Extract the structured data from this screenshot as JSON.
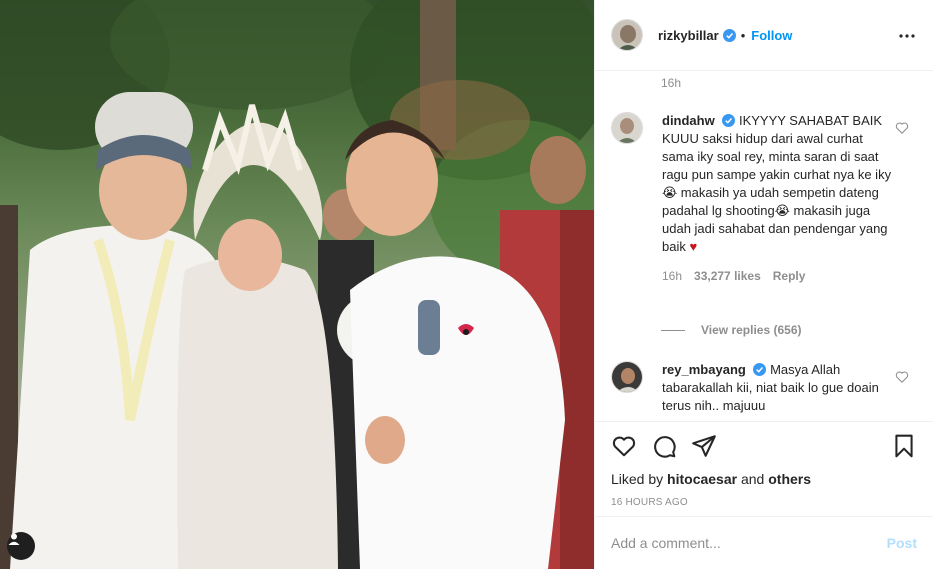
{
  "header": {
    "username": "rizkybillar",
    "separator": "•",
    "follow_label": "Follow"
  },
  "caption": {
    "time": "16h"
  },
  "comments": [
    {
      "username": "dindahw",
      "verified": true,
      "text": "IKYYYY SAHABAT BAIK KUUU saksi hidup dari awal curhat sama iky soal rey, minta saran di saat ragu pun sampe yakin curhat nya ke iky 😭 makasih ya udah sempetin dateng padahal lg shooting😭 makasih juga udah jadi sahabat dan pendengar yang baik",
      "emoji": "♥",
      "time": "16h",
      "likes": "33,277 likes",
      "reply_label": "Reply",
      "view_replies": "View replies (656)"
    },
    {
      "username": "rey_mbayang",
      "verified": true,
      "text": "Masya Allah tabarakallah kii, niat baik lo gue doain terus nih.. majuuu"
    }
  ],
  "actions": {
    "liked_prefix": "Liked by",
    "liked_user": "hitocaesar",
    "liked_and": "and",
    "liked_others": "others",
    "post_time": "16 HOURS AGO"
  },
  "add_comment": {
    "placeholder": "Add a comment...",
    "post_label": "Post"
  },
  "colors": {
    "follow_blue": "#0095f6",
    "verified_blue": "#3897f0",
    "post_disabled": "#b2dffc",
    "muted_gray": "#8e8e8e"
  }
}
